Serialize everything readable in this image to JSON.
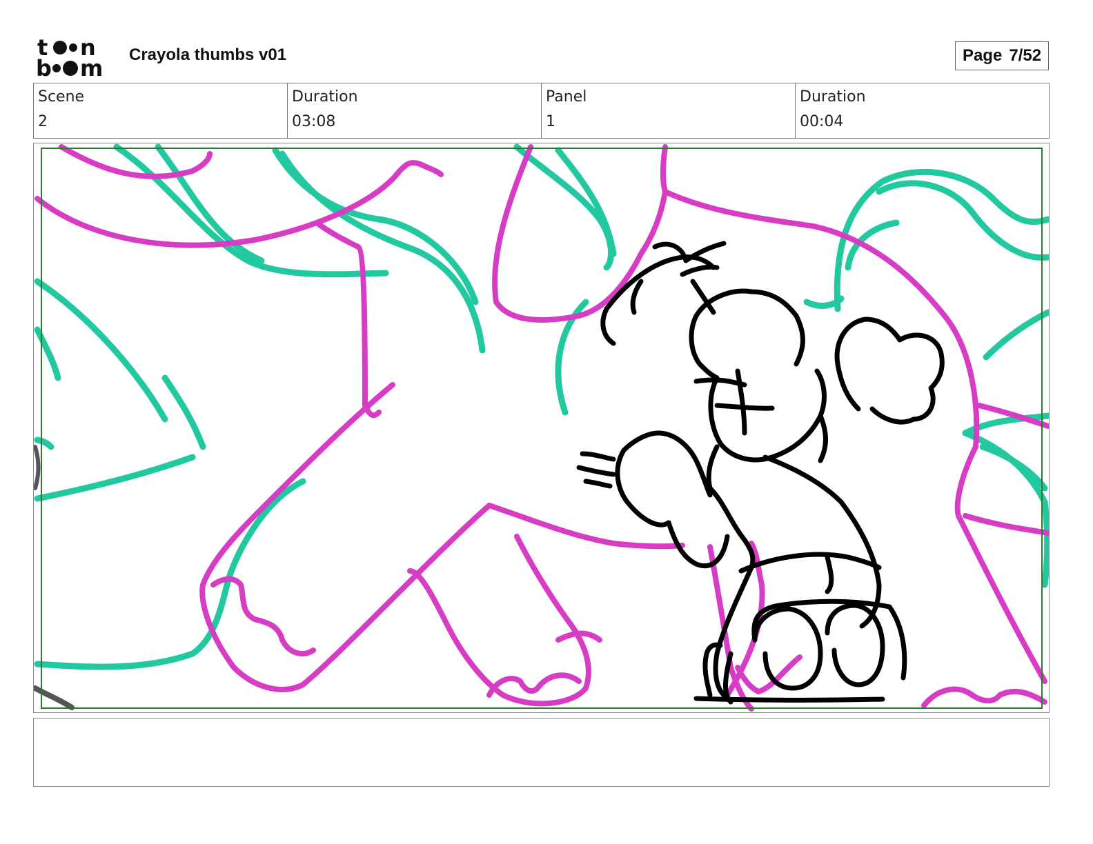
{
  "header": {
    "logo_alt": "toon boom",
    "doc_title": "Crayola thumbs v01",
    "page_label": "Page",
    "page_number": "7/52"
  },
  "info": [
    {
      "label": "Scene",
      "value": "2"
    },
    {
      "label": "Duration",
      "value": "03:08"
    },
    {
      "label": "Panel",
      "value": "1"
    },
    {
      "label": "Duration",
      "value": "00:04"
    }
  ],
  "colors": {
    "magenta_stroke": "#d63cc4",
    "teal_stroke": "#22c9a0",
    "ink_stroke": "#000000",
    "safe_frame": "#2a7a2a"
  },
  "notes": ""
}
